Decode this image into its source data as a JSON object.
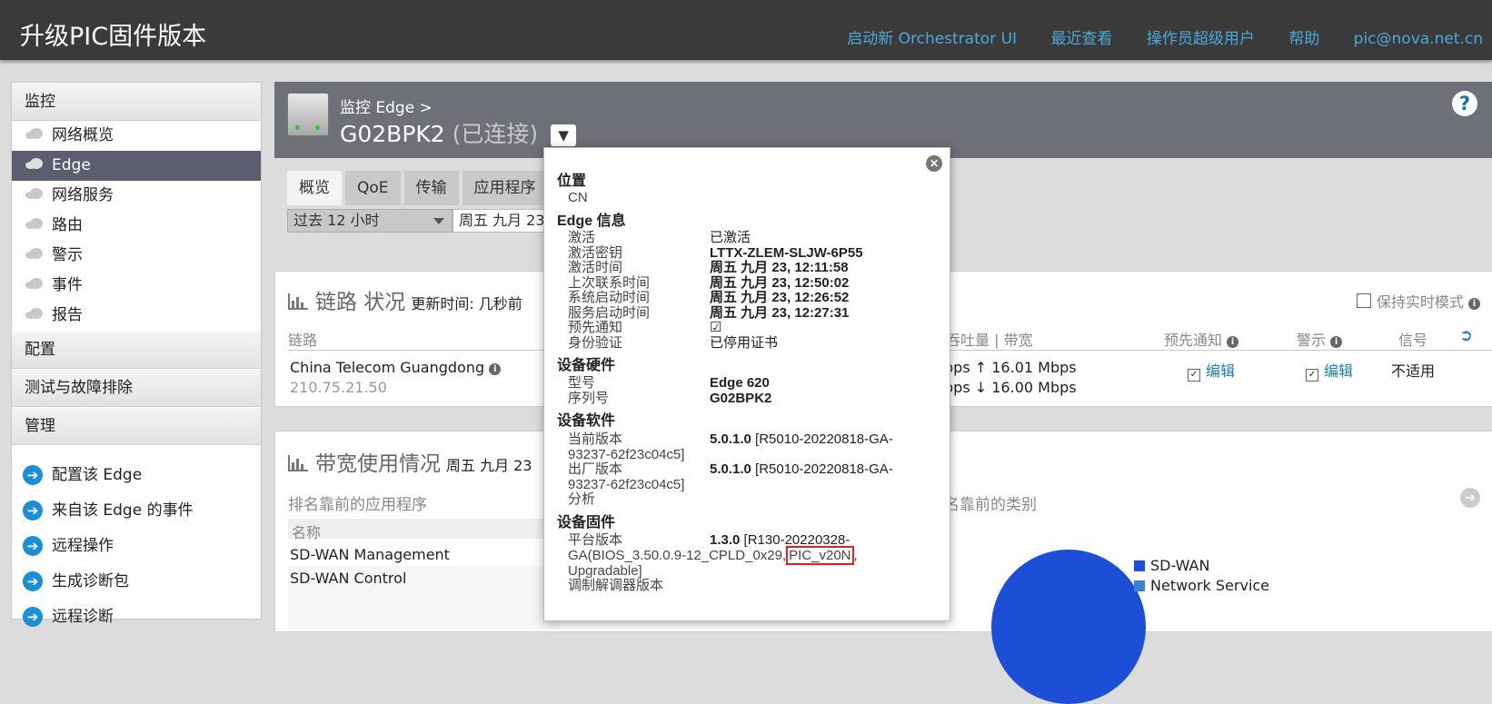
{
  "app": {
    "title": "升级PIC固件版本"
  },
  "topnav": [
    "启动新 Orchestrator UI",
    "最近查看",
    "操作员超级用户",
    "帮助",
    "pic@nova.net.cn"
  ],
  "sidebar": {
    "monitor_header": "监控",
    "monitor_items": [
      "网络概览",
      "Edge",
      "网络服务",
      "路由",
      "警示",
      "事件",
      "报告"
    ],
    "config_header": "配置",
    "test_header": "测试与故障排除",
    "manage_header": "管理",
    "actions": [
      "配置该 Edge",
      "来自该 Edge 的事件",
      "远程操作",
      "生成诊断包",
      "远程诊断"
    ]
  },
  "header": {
    "breadcrumb": "监控 Edge >",
    "edge_name": "G02BPK2",
    "edge_state": "(已连接)",
    "help": "?"
  },
  "tabs": [
    "概览",
    "QoE",
    "传输",
    "应用程序"
  ],
  "time": {
    "range": "过去 12 小时",
    "date": "周五 九月 23"
  },
  "link_panel": {
    "title": "链路 状况",
    "updated": "更新时间: 几秒前",
    "realtime": "保持实时模式",
    "col_link": "链路",
    "col_throughput": "吞吐量 | 带宽",
    "col_preempt": "预先通知",
    "col_alert": "警示",
    "col_signal": "信号",
    "row": {
      "name": "China Telecom Guangdong",
      "ip": "210.75.21.50",
      "tp_partial1": "bps",
      "tp_up": "16.01 Mbps",
      "tp_partial2": "bps",
      "tp_down": "16.00 Mbps",
      "edit1": "编辑",
      "edit2": "编辑",
      "signal": "不适用"
    }
  },
  "bw_panel": {
    "title": "带宽使用情况",
    "date": "周五 九月 23",
    "top_apps": "排名靠前的应用程序",
    "top_cats": "名靠前的类别",
    "col_name": "名称",
    "apps": [
      "SD-WAN Management",
      "SD-WAN Control"
    ],
    "legend": [
      "SD-WAN",
      "Network Service"
    ],
    "pie_color": "#1d4fd6"
  },
  "popover": {
    "loc_title": "位置",
    "loc_value": "CN",
    "edge_info_title": "Edge 信息",
    "edge_info": [
      {
        "label": "激活",
        "value": "已激活",
        "bold": false
      },
      {
        "label": "激活密钥",
        "value": "LTTX-ZLEM-SLJW-6P55",
        "bold": true
      },
      {
        "label": "激活时间",
        "value": "周五 九月 23, 12:11:58",
        "bold": true
      },
      {
        "label": "上次联系时间",
        "value": "周五 九月 23, 12:50:02",
        "bold": true
      },
      {
        "label": "系统启动时间",
        "value": "周五 九月 23, 12:26:52",
        "bold": true
      },
      {
        "label": "服务启动时间",
        "value": "周五 九月 23, 12:27:31",
        "bold": true
      },
      {
        "label": "预先通知",
        "value": "☑",
        "bold": false
      },
      {
        "label": "身份验证",
        "value": "已停用证书",
        "bold": false
      }
    ],
    "hw_title": "设备硬件",
    "hw": [
      {
        "label": "型号",
        "value": "Edge 620"
      },
      {
        "label": "序列号",
        "value": "G02BPK2"
      }
    ],
    "sw_title": "设备软件",
    "sw_current_label": "当前版本",
    "sw_current_ver": "5.0.1.0",
    "sw_current_build": "[R5010-20220818-GA-",
    "sw_current_cont": "93237-62f23c04c5]",
    "sw_factory_label": "出厂版本",
    "sw_factory_ver": "5.0.1.0",
    "sw_factory_build": "[R5010-20220818-GA-",
    "sw_factory_cont": "93237-62f23c04c5]",
    "sw_analysis": "分析",
    "fw_title": "设备固件",
    "fw_platform_label": "平台版本",
    "fw_platform_ver": "1.3.0",
    "fw_platform_build": "[R130-20220328-",
    "fw_line2_pre": "GA(BIOS_3.50.0.9-12_CPLD_0x29,",
    "fw_line2_hl": "PIC_v20N",
    "fw_line2_post": ",",
    "fw_line3": "Upgradable]",
    "fw_modem": "调制解调器版本",
    "highlight_color": "#e02020"
  }
}
